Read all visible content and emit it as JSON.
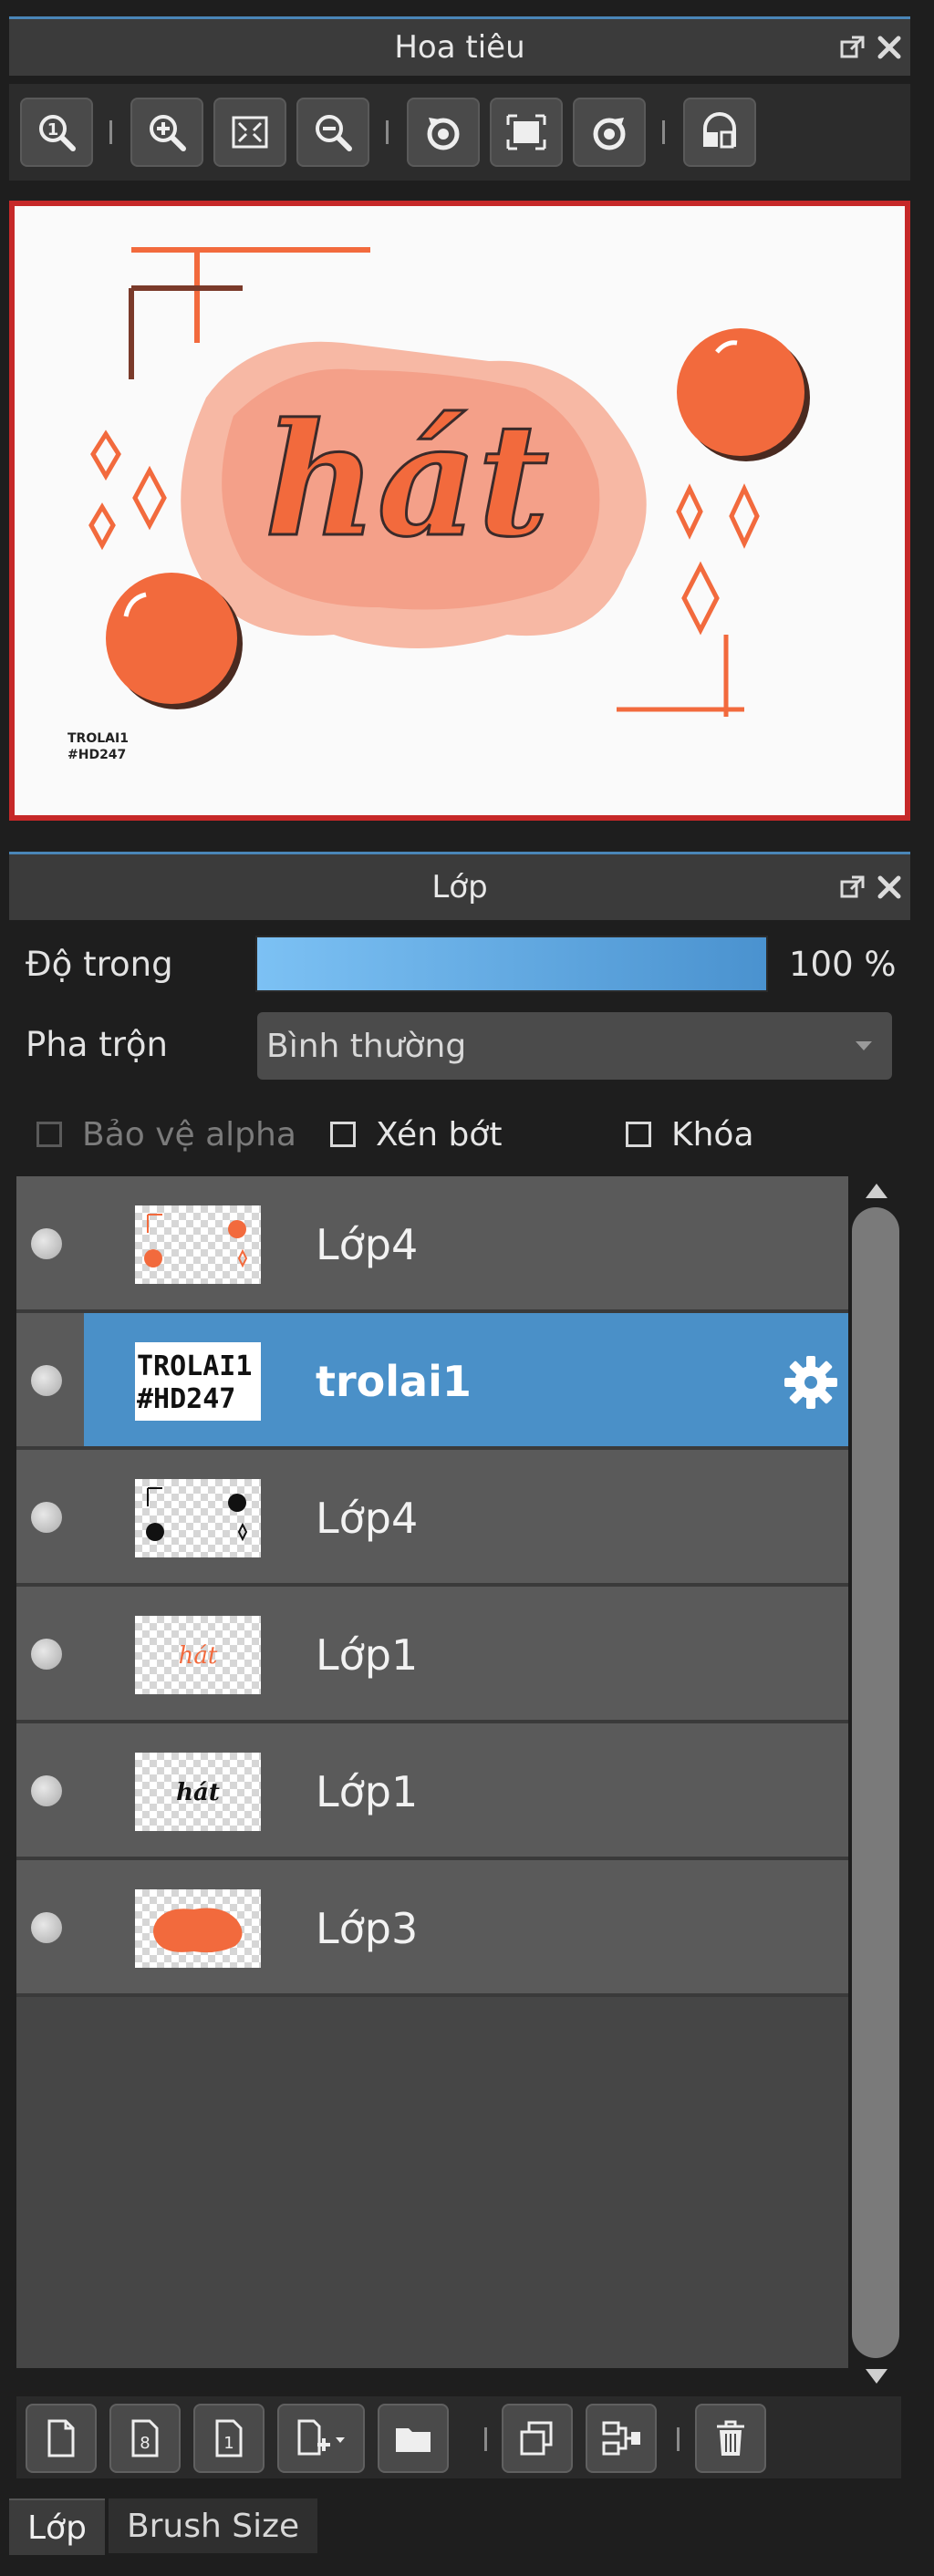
{
  "navigator": {
    "title": "Hoa tiêu",
    "tools": [
      {
        "icon": "zoom-actual-icon"
      },
      {
        "icon": "zoom-in-icon"
      },
      {
        "icon": "fit-window-icon"
      },
      {
        "icon": "zoom-out-icon"
      },
      {
        "icon": "rotate-left-icon"
      },
      {
        "icon": "reset-view-icon"
      },
      {
        "icon": "rotate-right-icon"
      },
      {
        "icon": "flip-horizontal-icon"
      }
    ],
    "preview": {
      "word": "hát",
      "watermark_line1": "TROLAI1",
      "watermark_line2": "#HD247",
      "colors": {
        "accent": "#f26a3d",
        "blob_light": "#f7b8a4",
        "blob_dark": "#f4a089",
        "frame": "#c62828"
      }
    }
  },
  "layers_panel": {
    "title": "Lớp",
    "opacity_label": "Độ trong",
    "opacity_value": "100 %",
    "opacity": 1.0,
    "blend_label": "Pha trộn",
    "blend_value": "Bình thường",
    "protect_alpha": "Bảo vệ alpha",
    "clipping": "Xén bớt",
    "lock": "Khóa",
    "layers": [
      {
        "name": "Lớp4",
        "selected": false,
        "thumb": "orange-dots"
      },
      {
        "name": "trolai1",
        "selected": true,
        "thumb": "text",
        "thumb_text1": "TROLAI1",
        "thumb_text2": "#HD247"
      },
      {
        "name": "Lớp4",
        "selected": false,
        "thumb": "black-dots"
      },
      {
        "name": "Lớp1",
        "selected": false,
        "thumb": "hat-orange",
        "thumb_text": "hát"
      },
      {
        "name": "Lớp1",
        "selected": false,
        "thumb": "hat-black",
        "thumb_text": "hát"
      },
      {
        "name": "Lớp3",
        "selected": false,
        "thumb": "blob"
      }
    ],
    "selected_color": "#4a90c8",
    "bottom_tools": [
      {
        "icon": "new-layer-icon"
      },
      {
        "icon": "new-8bit-layer-icon",
        "text": "8"
      },
      {
        "icon": "new-1bit-layer-icon",
        "text": "1"
      },
      {
        "icon": "add-layer-menu-icon"
      },
      {
        "icon": "new-folder-icon"
      },
      {
        "icon": "duplicate-layer-icon"
      },
      {
        "icon": "merge-down-icon"
      },
      {
        "icon": "delete-layer-icon"
      }
    ]
  },
  "tabs": [
    {
      "label": "Lớp",
      "active": true
    },
    {
      "label": "Brush Size",
      "active": false
    }
  ]
}
